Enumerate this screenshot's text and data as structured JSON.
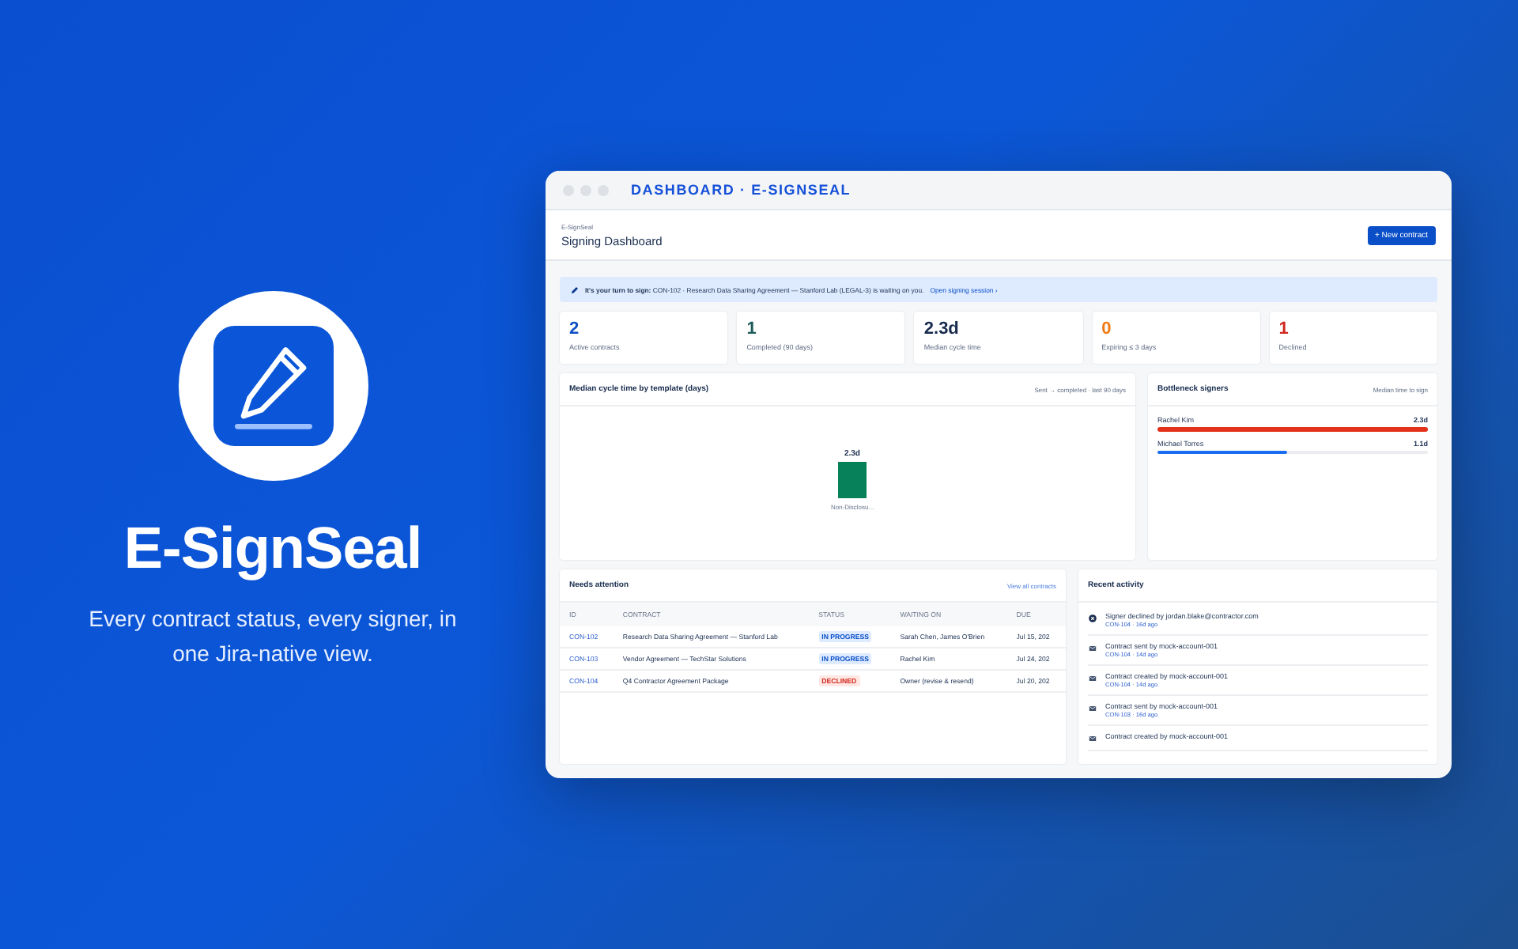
{
  "hero": {
    "title": "E-SignSeal",
    "tagline": "Every contract status, every signer, in one Jira-native view."
  },
  "window": {
    "title": "DASHBOARD · E-SIGNSEAL"
  },
  "header": {
    "breadcrumb": "E-SignSeal",
    "title": "Signing Dashboard",
    "button": "+ New contract"
  },
  "banner": {
    "text": "**It's your turn to sign:** CON-102 · Research Data Sharing Agreement — Stanford Lab (LEGAL-3) is waiting on you.",
    "link": "Open signing session ›"
  },
  "stats": [
    {
      "value": "2",
      "label": "Active contracts",
      "color": "#0c4fc4"
    },
    {
      "value": "1",
      "label": "Completed (90 days)",
      "color": "#1c5b5a"
    },
    {
      "value": "2.3d",
      "label": "Median cycle time",
      "color": "#172b4d"
    },
    {
      "value": "0",
      "label": "Expiring ≤ 3 days",
      "color": "#f07a12"
    },
    {
      "value": "1",
      "label": "Declined",
      "color": "#d0271d"
    }
  ],
  "cycle_chart": {
    "title": "Median cycle time by template (days)",
    "subtitle": "Sent → completed · last 90 days",
    "bars": [
      {
        "category": "Non-Disclosu...",
        "label": "2.3d"
      }
    ]
  },
  "bottleneck": {
    "title": "Bottleneck signers",
    "subtitle": "Median time to sign",
    "signers": [
      {
        "name": "Rachel Kim",
        "reading": "2.3d",
        "level": 1.0,
        "color": "#e5321b"
      },
      {
        "name": "Michael Torres",
        "reading": "1.1d",
        "level": 0.48,
        "color": "#1a6cf0"
      }
    ]
  },
  "attention": {
    "title": "Needs attention",
    "link": "View all contracts",
    "columns": [
      "ID",
      "CONTRACT",
      "STATUS",
      "WAITING ON",
      "DUE"
    ],
    "rows": [
      {
        "id": "CON-102",
        "contract": "Research Data Sharing Agreement — Stanford Lab",
        "status": "IN PROGRESS",
        "kind": "in_progress",
        "waiting": "Sarah Chen, James O'Brien",
        "due": "Jul 15, 202"
      },
      {
        "id": "CON-103",
        "contract": "Vendor Agreement — TechStar Solutions",
        "status": "IN PROGRESS",
        "kind": "in_progress",
        "waiting": "Rachel Kim",
        "due": "Jul 24, 202"
      },
      {
        "id": "CON-104",
        "contract": "Q4 Contractor Agreement Package",
        "status": "DECLINED",
        "kind": "declined",
        "waiting": "Owner (revise & resend)",
        "due": "Jul 20, 202"
      }
    ]
  },
  "activity": {
    "title": "Recent activity",
    "items": [
      {
        "kind": "declined",
        "text": "Signer declined by jordan.blake@contractor.com",
        "meta": "CON-104 · 16d ago"
      },
      {
        "kind": "document",
        "text": "Contract sent by mock-account-001",
        "meta": "CON-104 · 14d ago"
      },
      {
        "kind": "document",
        "text": "Contract created by mock-account-001",
        "meta": "CON-104 · 14d ago"
      },
      {
        "kind": "document",
        "text": "Contract sent by mock-account-001",
        "meta": "CON-103 · 16d ago"
      },
      {
        "kind": "document",
        "text": "Contract created by mock-account-001"
      }
    ]
  }
}
